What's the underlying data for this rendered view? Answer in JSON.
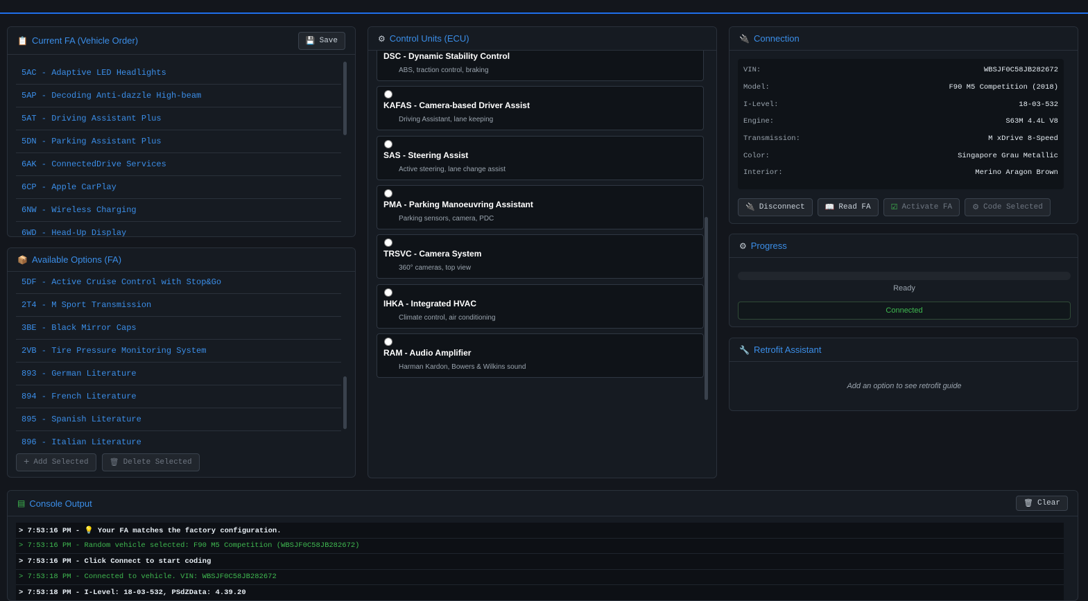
{
  "fa_panel": {
    "title": "Current FA (Vehicle Order)",
    "save_label": "Save",
    "items": [
      "5AC - Adaptive LED Headlights",
      "5AP - Decoding Anti-dazzle High-beam",
      "5AT - Driving Assistant Plus",
      "5DN - Parking Assistant Plus",
      "6AK - ConnectedDrive Services",
      "6CP - Apple CarPlay",
      "6NW - Wireless Charging",
      "6WD - Head-Up Display"
    ]
  },
  "options_panel": {
    "title": "Available Options (FA)",
    "items": [
      "5DF - Active Cruise Control with Stop&Go",
      "2T4 - M Sport Transmission",
      "3BE - Black Mirror Caps",
      "2VB - Tire Pressure Monitoring System",
      "893 - German Literature",
      "894 - French Literature",
      "895 - Spanish Literature",
      "896 - Italian Literature"
    ],
    "add_label": "Add Selected",
    "delete_label": "Delete Selected"
  },
  "ecu_panel": {
    "title": "Control Units (ECU)",
    "items": [
      {
        "name": "DSC - Dynamic Stability Control",
        "desc": "ABS, traction control, braking"
      },
      {
        "name": "KAFAS - Camera-based Driver Assist",
        "desc": "Driving Assistant, lane keeping"
      },
      {
        "name": "SAS - Steering Assist",
        "desc": "Active steering, lane change assist"
      },
      {
        "name": "PMA - Parking Manoeuvring Assistant",
        "desc": "Parking sensors, camera, PDC"
      },
      {
        "name": "TRSVC - Camera System",
        "desc": "360° cameras, top view"
      },
      {
        "name": "IHKA - Integrated HVAC",
        "desc": "Climate control, air conditioning"
      },
      {
        "name": "RAM - Audio Amplifier",
        "desc": "Harman Kardon, Bowers & Wilkins sound"
      }
    ]
  },
  "connection": {
    "title": "Connection",
    "rows": [
      {
        "k": "VIN:",
        "v": "WBSJF0C58JB282672"
      },
      {
        "k": "Model:",
        "v": "F90 M5 Competition (2018)"
      },
      {
        "k": "I-Level:",
        "v": "18-03-532"
      },
      {
        "k": "Engine:",
        "v": "S63M 4.4L V8"
      },
      {
        "k": "Transmission:",
        "v": "M xDrive 8-Speed"
      },
      {
        "k": "Color:",
        "v": "Singapore Grau Metallic"
      },
      {
        "k": "Interior:",
        "v": "Merino Aragon Brown"
      }
    ],
    "disconnect_label": "Disconnect",
    "read_label": "Read FA",
    "activate_label": "Activate FA",
    "code_label": "Code Selected"
  },
  "progress": {
    "title": "Progress",
    "value": 0,
    "status": "Ready",
    "connection_status": "Connected"
  },
  "retrofit": {
    "title": "Retrofit Assistant",
    "placeholder": "Add an option to see retrofit guide"
  },
  "console": {
    "title": "Console Output",
    "clear_label": "Clear",
    "lines": [
      {
        "text": "> 7:53:16 PM - 💡 Your FA matches the factory configuration.",
        "style": "white"
      },
      {
        "text": "> 7:53:16 PM - Random vehicle selected: F90 M5 Competition (WBSJF0C58JB282672)",
        "style": "green"
      },
      {
        "text": "> 7:53:16 PM - Click Connect to start coding",
        "style": "white"
      },
      {
        "text": "> 7:53:18 PM - Connected to vehicle. VIN: WBSJF0C58JB282672",
        "style": "green"
      },
      {
        "text": "> 7:53:18 PM - I-Level: 18-03-532, PSdZData: 4.39.20",
        "style": "white"
      }
    ]
  },
  "colors": {
    "accent": "#3b8ee8",
    "success": "#3fb950",
    "background": "#13161c"
  }
}
